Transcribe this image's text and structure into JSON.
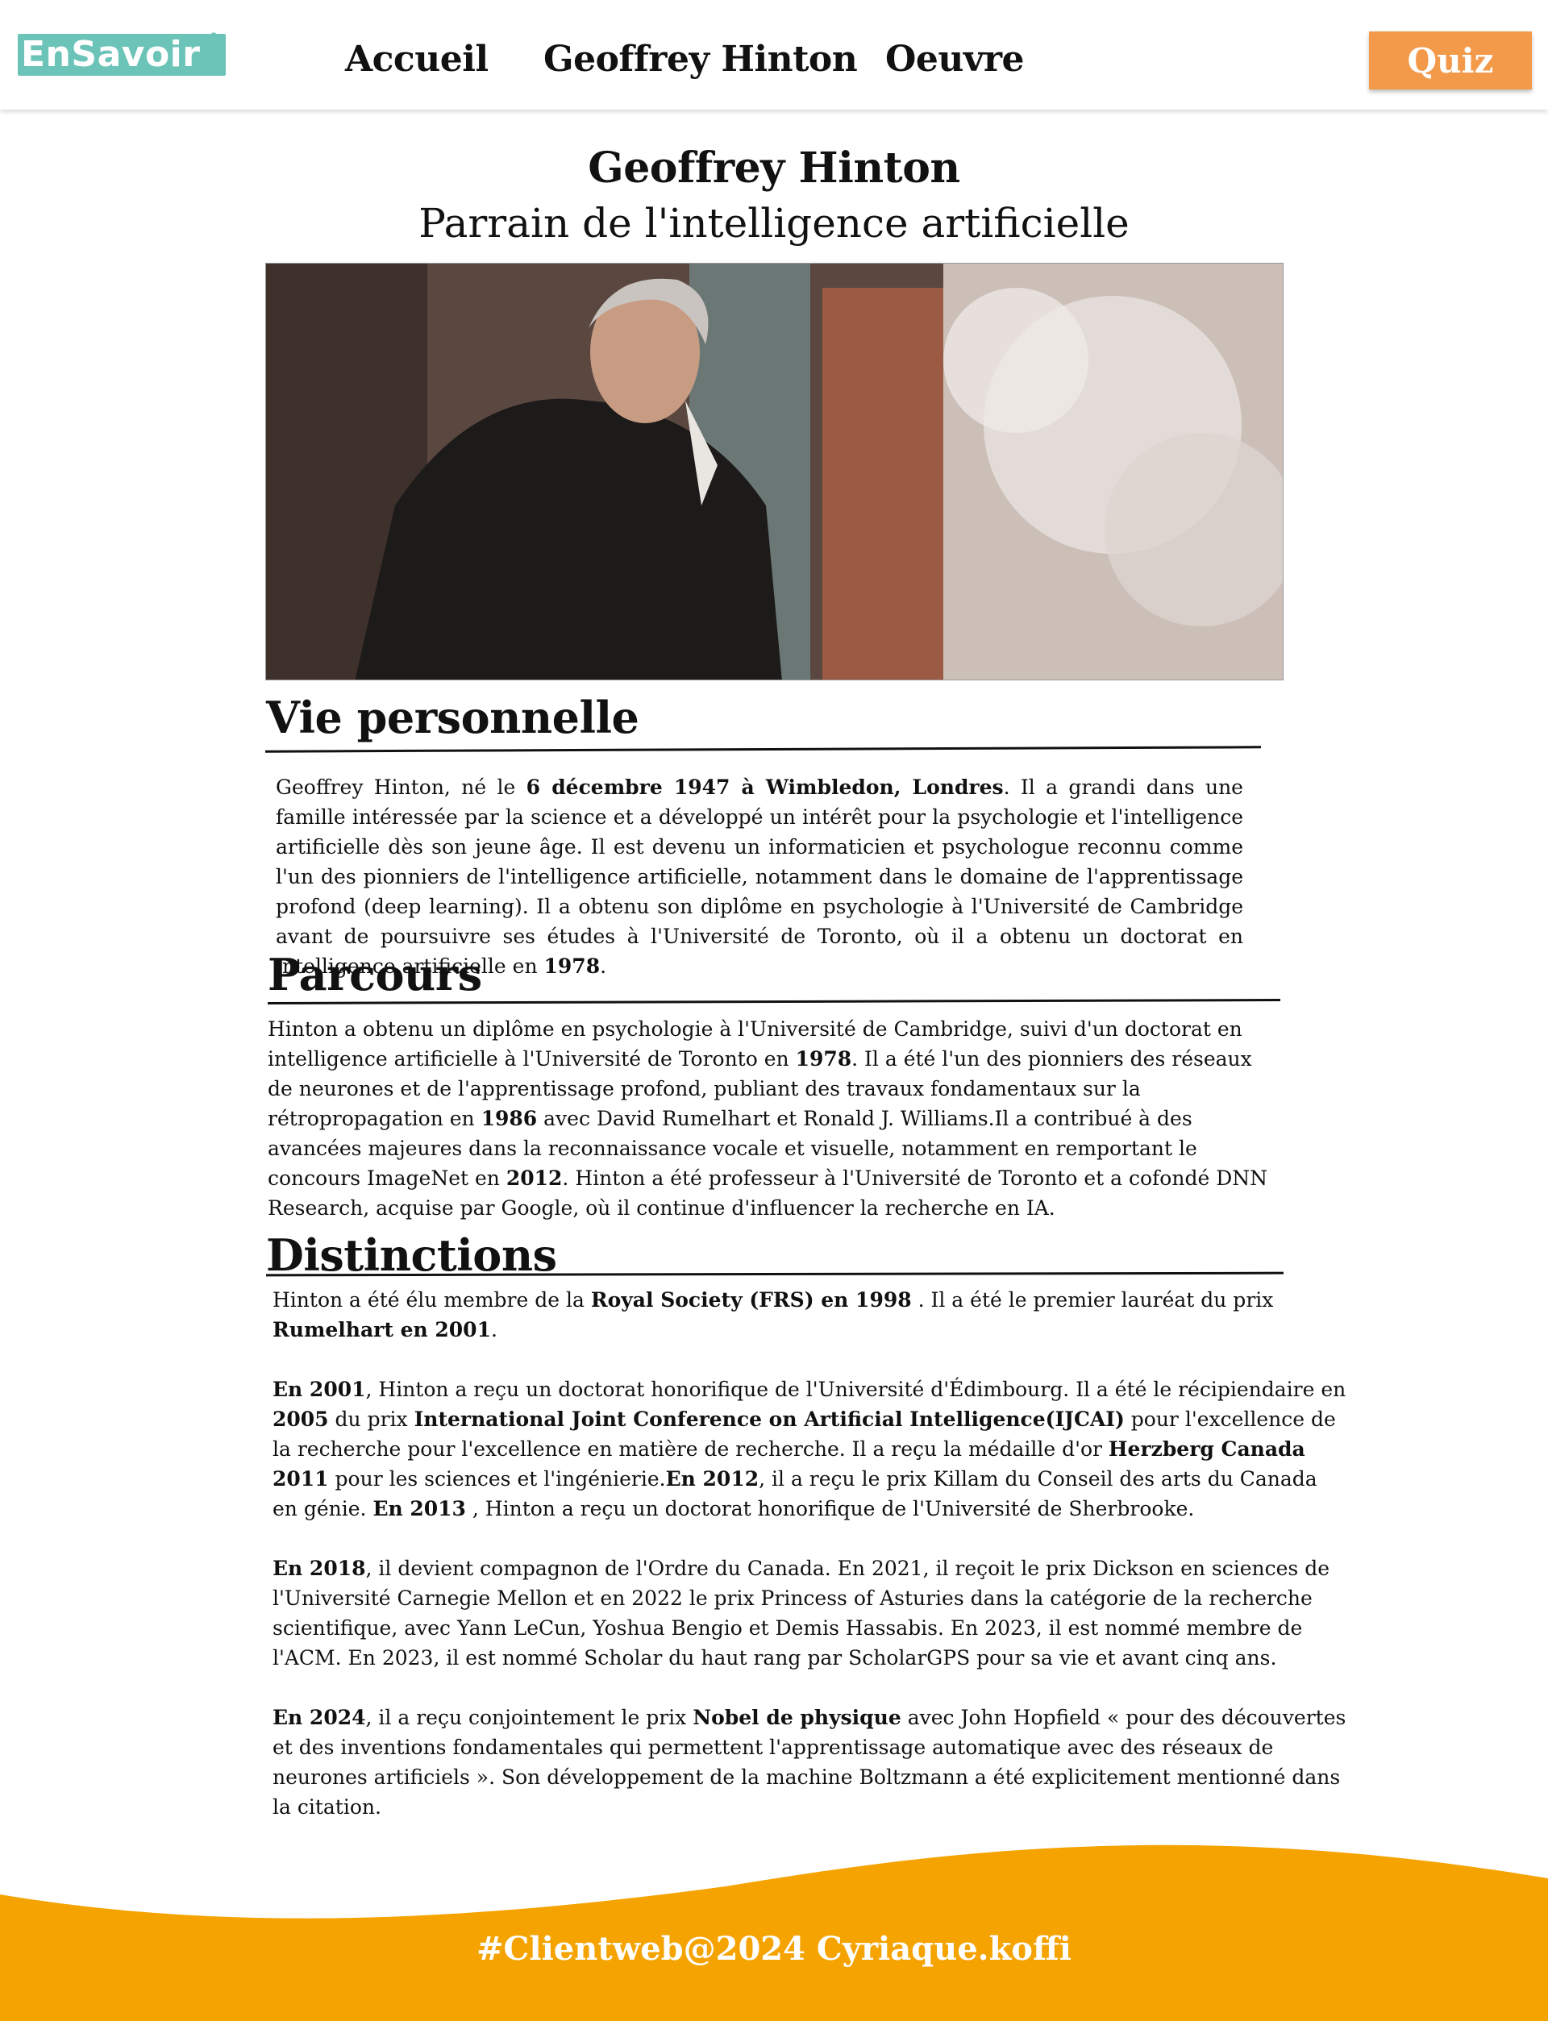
{
  "header": {
    "logo_text": "EnSavoir",
    "logo_plus": "+",
    "nav": [
      "Accueil",
      "Geoffrey Hinton",
      "Oeuvre"
    ],
    "quiz_label": "Quiz"
  },
  "hero": {
    "title": "Geoffrey Hinton",
    "subtitle": "Parrain de l'intelligence artificielle"
  },
  "sections": {
    "vie": {
      "heading": "Vie personnelle",
      "segments": [
        [
          "Geoffrey Hinton, né le ",
          false
        ],
        [
          "6 décembre 1947 à Wimbledon, Londres",
          true
        ],
        [
          ". Il a grandi dans une famille intéressée par la science et a développé un intérêt pour la psychologie et l'intelligence artificielle dès son jeune âge. Il est devenu un informaticien et psychologue reconnu comme l'un des pionniers de l'intelligence artificielle, notamment dans le domaine de l'apprentissage profond (deep learning). Il a obtenu son diplôme en psychologie à l'Université de Cambridge avant de poursuivre ses études à l'Université de Toronto, où il a obtenu un doctorat en intelligence artificielle en ",
          false
        ],
        [
          "1978",
          true
        ],
        [
          ".",
          false
        ]
      ]
    },
    "parcours": {
      "heading": "Parcours",
      "segments": [
        [
          "Hinton a obtenu un diplôme en psychologie à l'Université de Cambridge, suivi d'un doctorat en intelligence artificielle à l'Université de Toronto en ",
          false
        ],
        [
          "1978",
          true
        ],
        [
          ". Il a été l'un des pionniers des réseaux de neurones et de l'apprentissage profond, publiant des travaux fondamentaux sur la rétropropagation en ",
          false
        ],
        [
          "1986",
          true
        ],
        [
          " avec David Rumelhart et Ronald J. Williams.Il a contribué à des avancées majeures dans la reconnaissance vocale et visuelle, notamment en remportant le concours ImageNet en ",
          false
        ],
        [
          "2012",
          true
        ],
        [
          ". Hinton a été professeur à l'Université de Toronto et a cofondé DNN Research, acquise par Google, où il continue d'influencer la recherche en IA.",
          false
        ]
      ]
    },
    "distinctions": {
      "heading": "Distinctions",
      "paragraphs": [
        [
          [
            "Hinton a été élu membre de la ",
            false
          ],
          [
            "Royal Society (FRS) en 1998",
            true
          ],
          [
            " . Il a été le premier lauréat du prix ",
            false
          ],
          [
            "Rumelhart en 2001",
            true
          ],
          [
            ".",
            false
          ]
        ],
        [
          [
            "En 2001",
            true
          ],
          [
            ", Hinton a reçu un doctorat honorifique de l'Université d'Édimbourg. Il a été le récipiendaire en ",
            false
          ],
          [
            "2005",
            true
          ],
          [
            " du prix ",
            false
          ],
          [
            "International Joint Conference on Artificial Intelligence(IJCAI)",
            true
          ],
          [
            " pour l'excellence de la recherche pour l'excellence en matière de recherche. Il a reçu la médaille d'or ",
            false
          ],
          [
            "Herzberg Canada 2011",
            true
          ],
          [
            " pour les sciences et l'ingénierie.",
            false
          ],
          [
            "En 2012",
            true
          ],
          [
            ", il a reçu le prix Killam du Conseil des arts du Canada en génie. ",
            false
          ],
          [
            "En 2013",
            true
          ],
          [
            " , Hinton a reçu un doctorat honorifique de l'Université de Sherbrooke.",
            false
          ]
        ],
        [
          [
            "En 2018",
            true
          ],
          [
            ", il devient compagnon de l'Ordre du Canada. En 2021, il reçoit le prix Dickson en sciences de l'Université Carnegie Mellon et en 2022 le prix Princess of Asturies dans la catégorie de la recherche scientifique, avec Yann LeCun, Yoshua Bengio et Demis Hassabis. En 2023, il est nommé membre de l'ACM. En 2023, il est nommé Scholar du haut rang par ScholarGPS pour sa vie et avant cinq ans.",
            false
          ]
        ],
        [
          [
            "En 2024",
            true
          ],
          [
            ", il a reçu conjointement le prix ",
            false
          ],
          [
            "Nobel de physique",
            true
          ],
          [
            " avec John Hopfield « pour des découvertes et des inventions fondamentales qui permettent l'apprentissage automatique avec des réseaux de neurones artificiels ». Son développement de la machine Boltzmann a été explicitement mentionné dans la citation.",
            false
          ]
        ]
      ]
    }
  },
  "footer": {
    "text": "#Clientweb@2024 Cyriaque.koffi"
  },
  "colors": {
    "logo": "#6cc3b8",
    "quiz": "#f2994a",
    "footer_wave": "#f5a300"
  }
}
